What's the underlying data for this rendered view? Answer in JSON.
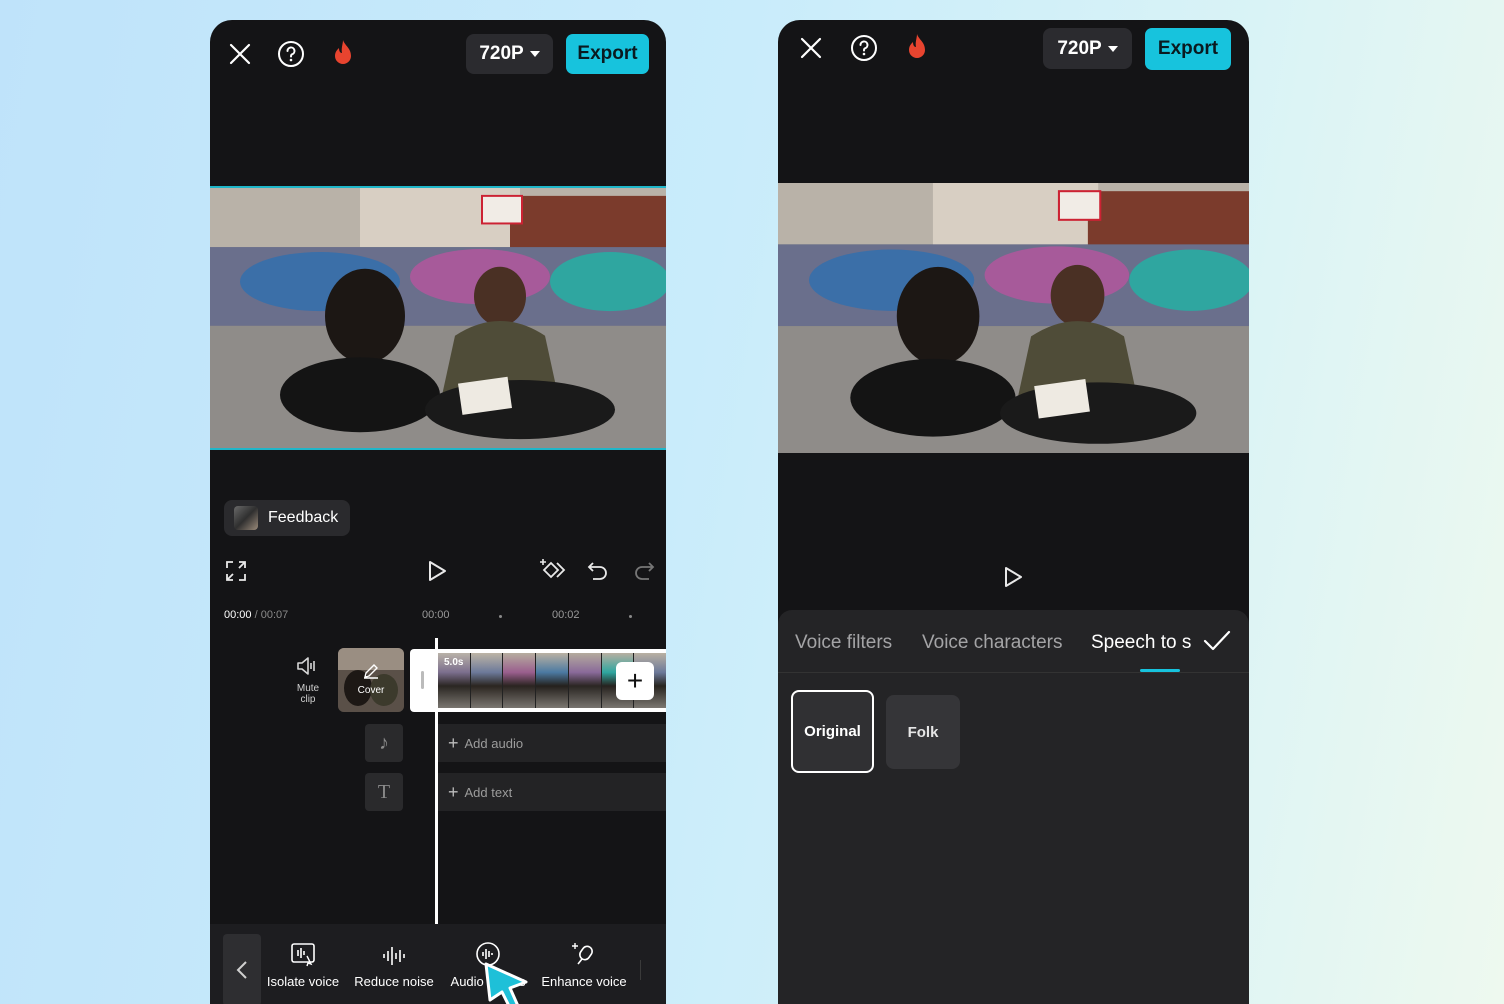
{
  "left_editor": {
    "resolution": "720P",
    "export_label": "Export",
    "feedback_label": "Feedback",
    "timecode_current": "00:00",
    "timecode_total": "/ 00:07",
    "ruler_ticks": [
      "00:00",
      "00:02"
    ],
    "mute_clip_label": "Mute\nclip",
    "cover_label": "Cover",
    "clip_duration": "5.0s",
    "add_audio_label": "Add audio",
    "add_text_label": "Add text",
    "toolbar": {
      "isolate_voice": "Isolate voice",
      "reduce_noise": "Reduce noise",
      "audio_effects": "Audio effects",
      "enhance_voice": "Enhance voice"
    }
  },
  "right_editor": {
    "resolution": "720P",
    "export_label": "Export",
    "tabs": [
      "Voice filters",
      "Voice characters",
      "Speech to song"
    ],
    "voice_options": [
      "Original",
      "Folk"
    ]
  },
  "colors": {
    "accent": "#17c3dd",
    "phone_bg": "#141416",
    "fire_icon": "#e8442f"
  }
}
